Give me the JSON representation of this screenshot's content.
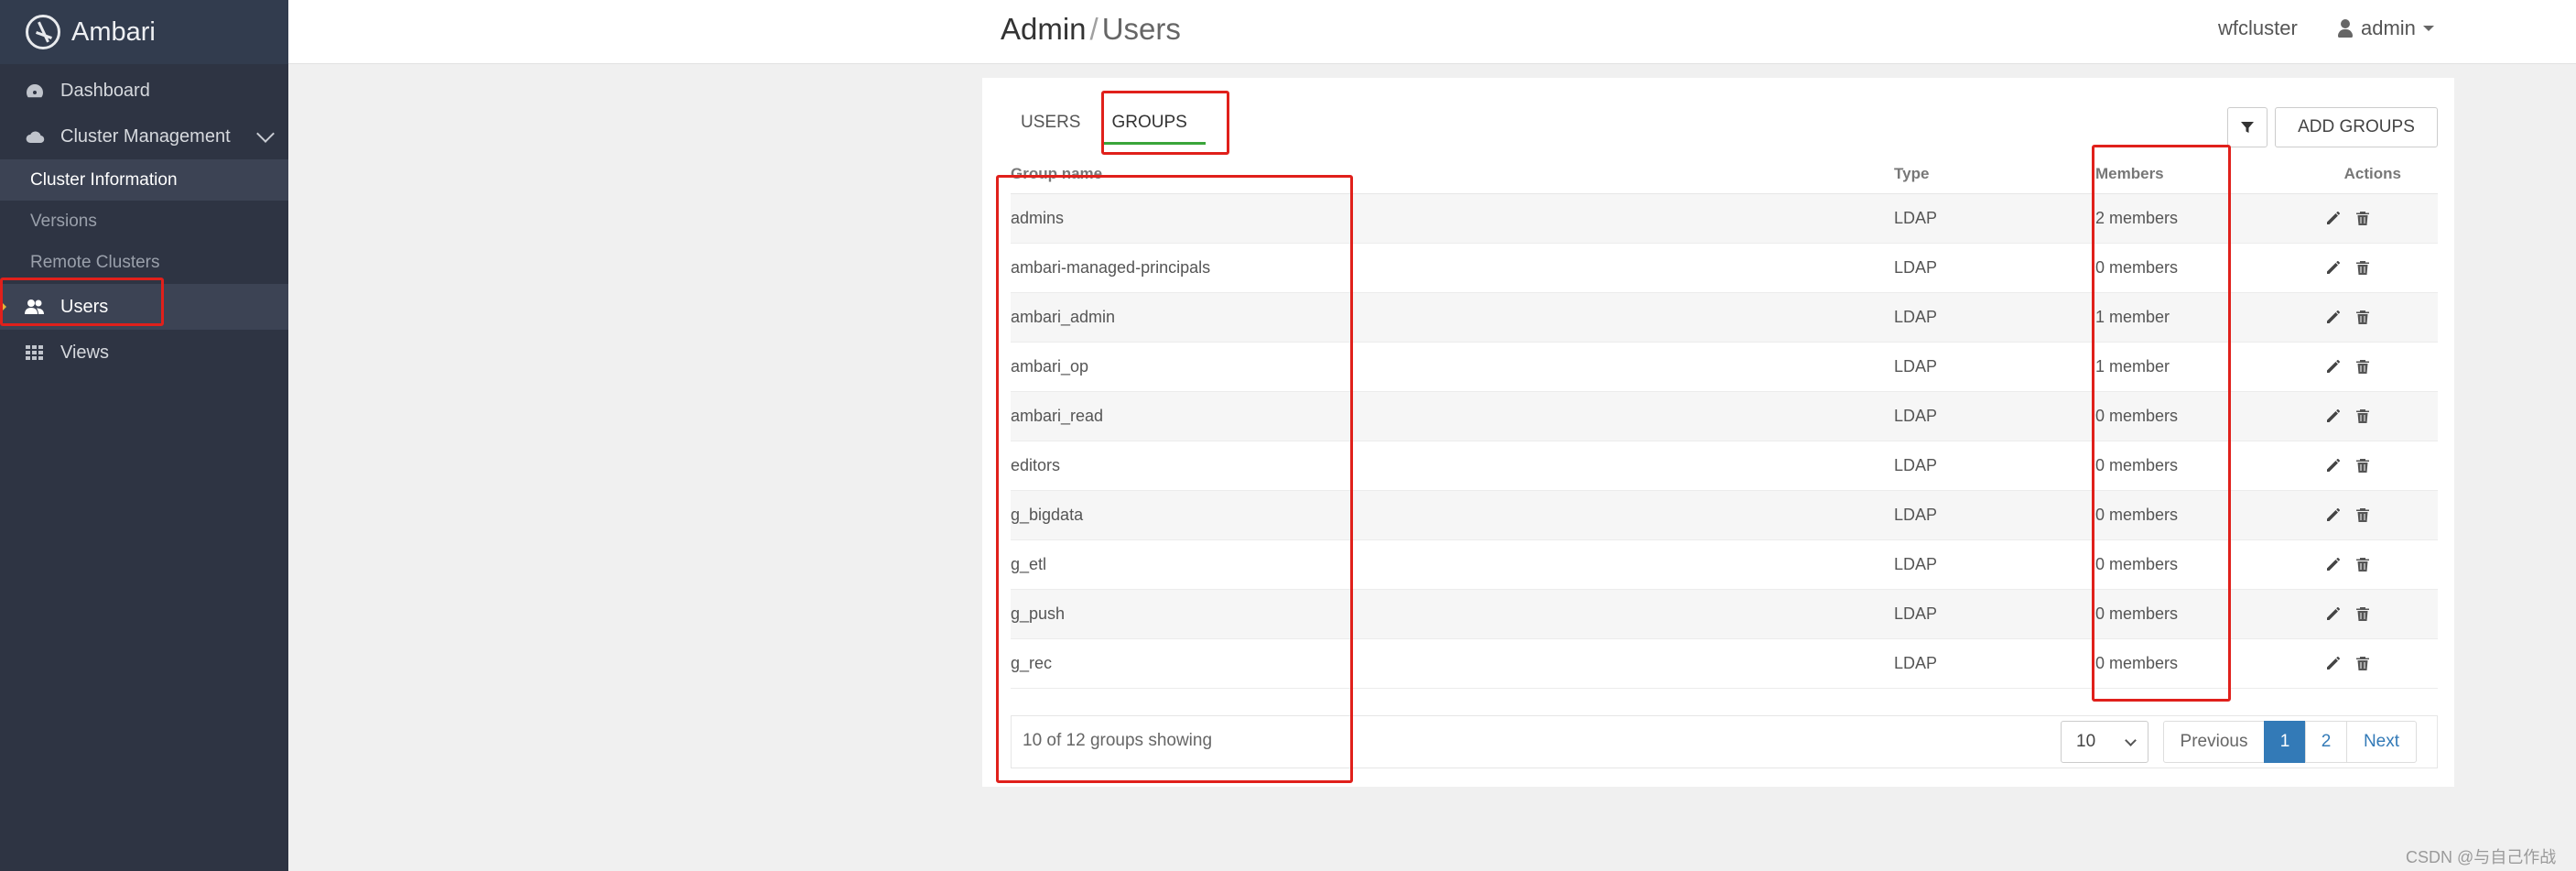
{
  "app": {
    "name": "Ambari"
  },
  "sidebar": {
    "dashboard": "Dashboard",
    "cluster_management": "Cluster Management",
    "sub_items": [
      "Cluster Information",
      "Versions",
      "Remote Clusters"
    ],
    "users": "Users",
    "views": "Views"
  },
  "header": {
    "title_root": "Admin",
    "title_sep": "/",
    "title_current": "Users",
    "cluster": "wfcluster",
    "user": "admin"
  },
  "tabs": {
    "users": "USERS",
    "groups": "GROUPS"
  },
  "toolbar": {
    "add_label": "ADD GROUPS"
  },
  "table": {
    "headers": {
      "name": "Group name",
      "type": "Type",
      "members": "Members",
      "actions": "Actions"
    },
    "rows": [
      {
        "name": "admins",
        "type": "LDAP",
        "members": "2 members"
      },
      {
        "name": "ambari-managed-principals",
        "type": "LDAP",
        "members": "0 members"
      },
      {
        "name": "ambari_admin",
        "type": "LDAP",
        "members": "1 member"
      },
      {
        "name": "ambari_op",
        "type": "LDAP",
        "members": "1 member"
      },
      {
        "name": "ambari_read",
        "type": "LDAP",
        "members": "0 members"
      },
      {
        "name": "editors",
        "type": "LDAP",
        "members": "0 members"
      },
      {
        "name": "g_bigdata",
        "type": "LDAP",
        "members": "0 members"
      },
      {
        "name": "g_etl",
        "type": "LDAP",
        "members": "0 members"
      },
      {
        "name": "g_push",
        "type": "LDAP",
        "members": "0 members"
      },
      {
        "name": "g_rec",
        "type": "LDAP",
        "members": "0 members"
      }
    ]
  },
  "footer": {
    "showing": "10 of 12 groups showing",
    "page_size": "10",
    "prev": "Previous",
    "pages": [
      "1",
      "2"
    ],
    "next": "Next"
  },
  "icons": {
    "edit": "pencil-icon",
    "delete": "trash-icon",
    "filter": "filter-icon"
  },
  "colors": {
    "accent": "#337ab7",
    "tab_underline": "#3aa53a",
    "annotation": "#e0201b",
    "sidebar_bg": "#2e3443"
  },
  "watermark": "CSDN @与自己作战"
}
